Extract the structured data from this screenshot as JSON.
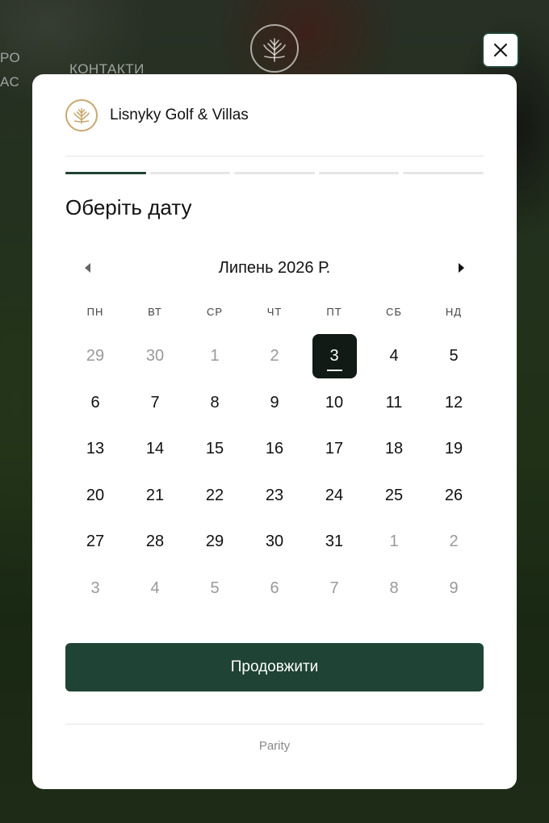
{
  "background": {
    "nav_about": "РО",
    "nav_us": "АС",
    "nav_contacts": "КОНТАКТИ"
  },
  "brand": {
    "name": "Lisnyky Golf & Villas"
  },
  "steps": {
    "total": 5,
    "active": 1
  },
  "title": "Оберіть дату",
  "calendar": {
    "month_label": "Липень 2026 Р.",
    "weekdays": [
      "ПН",
      "ВТ",
      "СР",
      "ЧТ",
      "ПТ",
      "СБ",
      "НД"
    ],
    "days": [
      {
        "label": "29",
        "muted": true
      },
      {
        "label": "30",
        "muted": true
      },
      {
        "label": "1",
        "muted": true
      },
      {
        "label": "2",
        "muted": true
      },
      {
        "label": "3",
        "selected": true
      },
      {
        "label": "4"
      },
      {
        "label": "5"
      },
      {
        "label": "6"
      },
      {
        "label": "7"
      },
      {
        "label": "8"
      },
      {
        "label": "9"
      },
      {
        "label": "10"
      },
      {
        "label": "11"
      },
      {
        "label": "12"
      },
      {
        "label": "13"
      },
      {
        "label": "14"
      },
      {
        "label": "15"
      },
      {
        "label": "16"
      },
      {
        "label": "17"
      },
      {
        "label": "18"
      },
      {
        "label": "19"
      },
      {
        "label": "20"
      },
      {
        "label": "21"
      },
      {
        "label": "22"
      },
      {
        "label": "23"
      },
      {
        "label": "24"
      },
      {
        "label": "25"
      },
      {
        "label": "26"
      },
      {
        "label": "27"
      },
      {
        "label": "28"
      },
      {
        "label": "29"
      },
      {
        "label": "30"
      },
      {
        "label": "31"
      },
      {
        "label": "1",
        "muted": true
      },
      {
        "label": "2",
        "muted": true
      },
      {
        "label": "3",
        "muted": true
      },
      {
        "label": "4",
        "muted": true
      },
      {
        "label": "5",
        "muted": true
      },
      {
        "label": "6",
        "muted": true
      },
      {
        "label": "7",
        "muted": true
      },
      {
        "label": "8",
        "muted": true
      },
      {
        "label": "9",
        "muted": true
      }
    ]
  },
  "continue_label": "Продовжити",
  "footer": "Parity",
  "colors": {
    "accent": "#1f4334",
    "selected_day": "#111a15",
    "brand_gold": "#c9a86f"
  },
  "icons": {
    "close": "close-icon",
    "prev": "chevron-left-icon",
    "next": "chevron-right-icon",
    "logo": "tree-logo-icon"
  }
}
